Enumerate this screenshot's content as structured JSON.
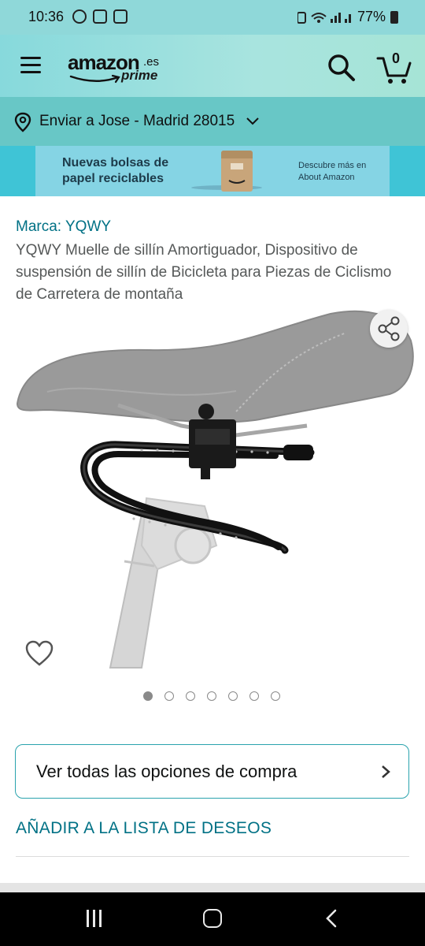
{
  "status_bar": {
    "time": "10:36",
    "battery": "77%"
  },
  "header": {
    "logo_text": "amazon",
    "logo_suffix": ".es",
    "logo_prime": "prime",
    "cart_count": "0"
  },
  "delivery": {
    "label": "Enviar a Jose - Madrid 28015"
  },
  "banner": {
    "title": "Nuevas bolsas de\npapel reciclables",
    "side_text": "Descubre más en\nAbout Amazon"
  },
  "product": {
    "brand": "Marca: YQWY",
    "title": "YQWY Muelle de sillín Amortiguador, Dispositivo de suspensión de sillín de Bicicleta para Piezas de Ciclismo de Carretera de montaña",
    "image_count": 7,
    "active_image": 1
  },
  "actions": {
    "buy_options": "Ver todas las opciones de compra",
    "wishlist": "AÑADIR A LA LISTA DE DESEOS"
  },
  "colors": {
    "header_teal": "#87d9dc",
    "delivery_teal": "#68c7c6",
    "link": "#007185"
  },
  "icons": [
    "menu-icon",
    "search-icon",
    "cart-icon",
    "location-pin-icon",
    "chevron-down-icon",
    "share-icon",
    "heart-icon",
    "chevron-right-icon",
    "recents-icon",
    "home-icon",
    "back-icon"
  ]
}
